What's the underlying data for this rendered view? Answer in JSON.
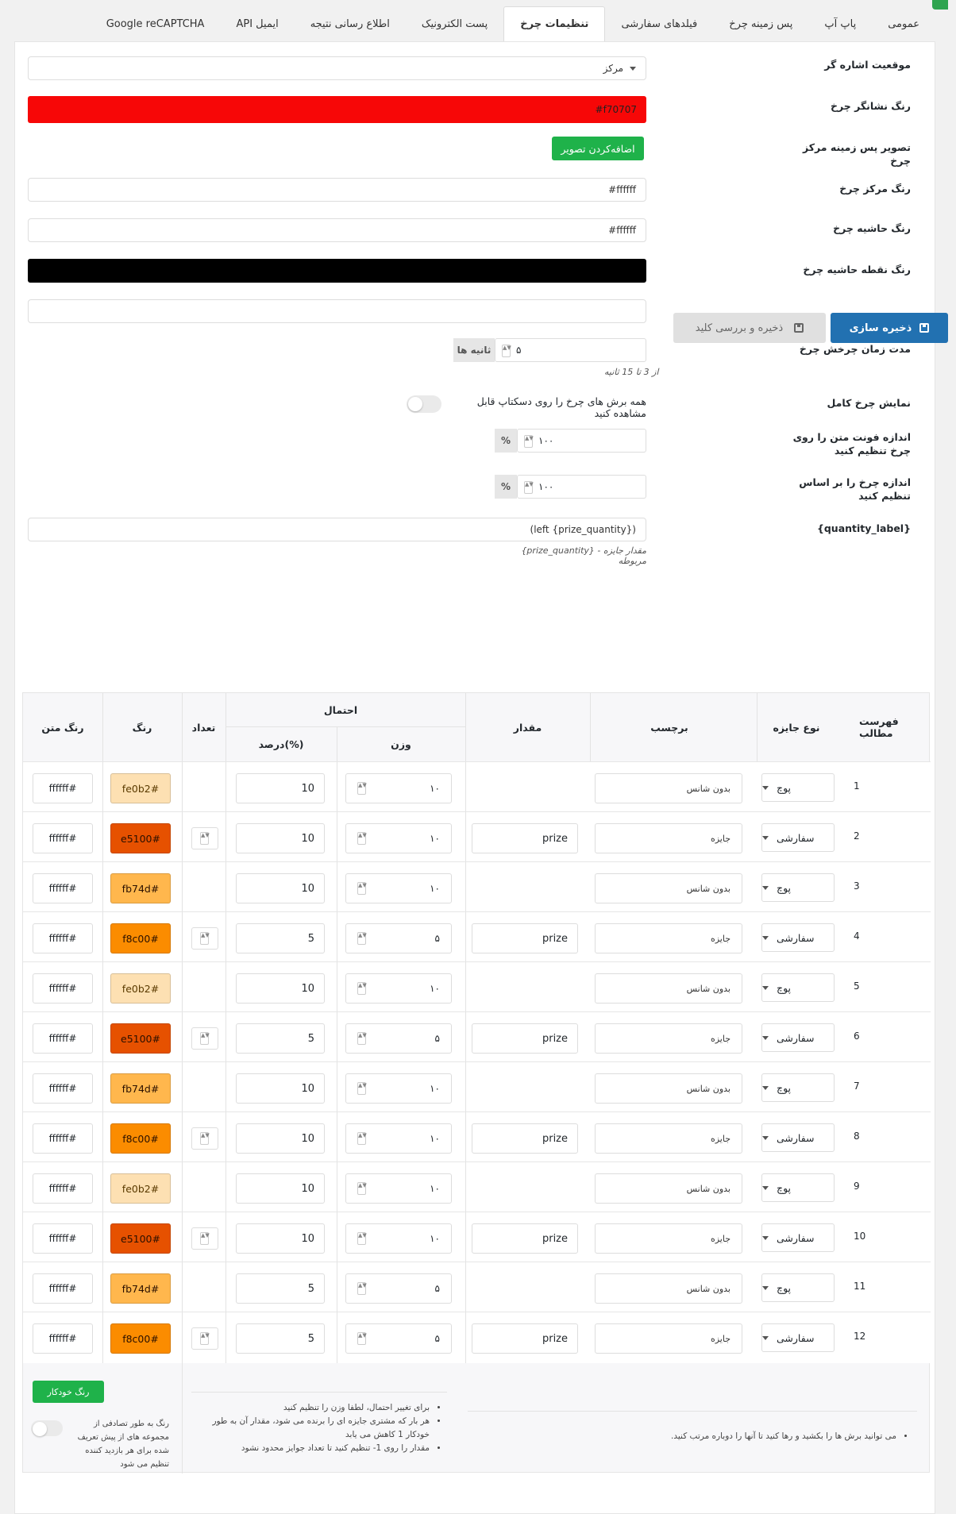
{
  "tabs": [
    "عمومی",
    "پاپ آپ",
    "پس زمینه چرخ",
    "فیلدهای سفارشی",
    "تنظیمات چرخ",
    "پست الکترونیک",
    "اطلاع رسانی نتیجه",
    "API ایمیل",
    "Google reCAPTCHA"
  ],
  "active_tab": "تنظیمات چرخ",
  "settings": {
    "pointer_position_label": "موقعیت اشاره گر",
    "pointer_position_value": "مرکز",
    "pointer_color_label": "رنگ نشانگر چرخ",
    "pointer_color_value": "#f70707",
    "center_bg_label": "تصویر پس زمینه مرکز چرخ",
    "add_image_button": "اضافه‌کردن تصویر",
    "center_color_label": "رنگ مرکز چرخ",
    "center_color_value": "#ffffff",
    "border_color_label": "رنگ حاشیه چرخ",
    "border_color_value": "#ffffff",
    "dot_color_label": "رنگ نقطه حاشیه چرخ",
    "dot_color_value": "#000000",
    "save_button": "ذخیره سازی",
    "save_check_button": "ذخیره و بررسی کلید",
    "spin_duration_label": "مدت زمان چرخش چرخ",
    "spin_duration_value": "۵",
    "spin_duration_unit": "ثانیه ها",
    "spin_duration_help": "از 3 تا 15 ثانیه",
    "full_wheel_label": "نمایش چرخ کامل",
    "full_wheel_desc": "همه برش های چرخ را روی دسکتاپ قابل مشاهده کنید",
    "font_size_label": "اندازه فونت متن را روی چرخ تنظیم کنید",
    "font_size_value": "۱۰۰",
    "percent_unit": "%",
    "wheel_size_label": "اندازه چرخ را بر اساس تنظیم کنید",
    "wheel_size_value": "۱۰۰",
    "quantity_label_label": "{quantity_label}",
    "quantity_label_value": "(left {prize_quantity})",
    "quantity_label_help": "{prize_quantity} - مقدار جایزه مربوطه"
  },
  "table": {
    "headers": {
      "index": "فهرست مطالب",
      "type": "نوع جایزه",
      "label": "برچسب",
      "value": "مقدار",
      "probability": "احتمال",
      "weight": "وزن",
      "percent": "درصد(%)",
      "quantity": "تعداد",
      "color": "رنگ",
      "text_color": "رنگ متن"
    },
    "rows": [
      {
        "n": "1",
        "type": "پوچ",
        "label": "بدون شانس",
        "value": "",
        "weight": "۱۰",
        "percent": "10",
        "qty": false,
        "color": "fe0b2#",
        "bg": "#fde0b2",
        "text_color": "ffffff#"
      },
      {
        "n": "2",
        "type": "سفارشی",
        "label": "جایزه",
        "value": "prize",
        "weight": "۱۰",
        "percent": "10",
        "qty": true,
        "color": "e5100#",
        "bg": "#e65100",
        "text_color": "ffffff#"
      },
      {
        "n": "3",
        "type": "پوچ",
        "label": "بدون شانس",
        "value": "",
        "weight": "۱۰",
        "percent": "10",
        "qty": false,
        "color": "fb74d#",
        "bg": "#ffb74d",
        "text_color": "ffffff#"
      },
      {
        "n": "4",
        "type": "سفارشی",
        "label": "جایزه",
        "value": "prize",
        "weight": "۵",
        "percent": "5",
        "qty": true,
        "color": "f8c00#",
        "bg": "#fb8c00",
        "text_color": "ffffff#"
      },
      {
        "n": "5",
        "type": "پوچ",
        "label": "بدون شانس",
        "value": "",
        "weight": "۱۰",
        "percent": "10",
        "qty": false,
        "color": "fe0b2#",
        "bg": "#fde0b2",
        "text_color": "ffffff#"
      },
      {
        "n": "6",
        "type": "سفارشی",
        "label": "جایزه",
        "value": "prize",
        "weight": "۵",
        "percent": "5",
        "qty": true,
        "color": "e5100#",
        "bg": "#e65100",
        "text_color": "ffffff#"
      },
      {
        "n": "7",
        "type": "پوچ",
        "label": "بدون شانس",
        "value": "",
        "weight": "۱۰",
        "percent": "10",
        "qty": false,
        "color": "fb74d#",
        "bg": "#ffb74d",
        "text_color": "ffffff#"
      },
      {
        "n": "8",
        "type": "سفارشی",
        "label": "جایزه",
        "value": "prize",
        "weight": "۱۰",
        "percent": "10",
        "qty": true,
        "color": "f8c00#",
        "bg": "#fb8c00",
        "text_color": "ffffff#"
      },
      {
        "n": "9",
        "type": "پوچ",
        "label": "بدون شانس",
        "value": "",
        "weight": "۱۰",
        "percent": "10",
        "qty": false,
        "color": "fe0b2#",
        "bg": "#fde0b2",
        "text_color": "ffffff#"
      },
      {
        "n": "10",
        "type": "سفارشی",
        "label": "جایزه",
        "value": "prize",
        "weight": "۱۰",
        "percent": "10",
        "qty": true,
        "color": "e5100#",
        "bg": "#e65100",
        "text_color": "ffffff#"
      },
      {
        "n": "11",
        "type": "پوچ",
        "label": "بدون شانس",
        "value": "",
        "weight": "۵",
        "percent": "5",
        "qty": false,
        "color": "fb74d#",
        "bg": "#ffb74d",
        "text_color": "ffffff#"
      },
      {
        "n": "12",
        "type": "سفارشی",
        "label": "جایزه",
        "value": "prize",
        "weight": "۵",
        "percent": "5",
        "qty": true,
        "color": "f8c00#",
        "bg": "#fb8c00",
        "text_color": "ffffff#"
      }
    ]
  },
  "footer": {
    "drag_note": "می توانید برش ها را بکشید و رها کنید تا آنها را دوباره مرتب کنید.",
    "notes": [
      "برای تغییر احتمال، لطفا وزن را تنظیم کنید",
      "هر بار که مشتری جایزه ای را برنده می شود، مقدار آن به طور خودکار 1 کاهش می یابد",
      "مقدار را روی 1- تنظیم کنید تا تعداد جوایز محدود نشود"
    ],
    "auto_color_button": "رنگ خودکار",
    "auto_color_desc": "رنگ به طور تصادفی از مجموعه های از پیش تعریف شده برای هر بازدید کننده تنظیم می شود"
  },
  "colors": {
    "accent": "#2271b1",
    "green": "#1fb24a"
  }
}
